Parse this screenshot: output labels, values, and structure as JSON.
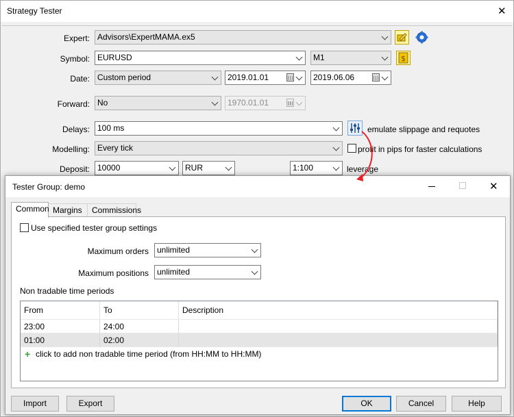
{
  "main_window": {
    "title": "Strategy Tester",
    "expert": {
      "label": "Expert:",
      "value": "Advisors\\ExpertMAMA.ex5"
    },
    "symbol": {
      "label": "Symbol:",
      "value": "EURUSD",
      "timeframe": "M1"
    },
    "date": {
      "label": "Date:",
      "period": "Custom period",
      "from": "2019.01.01",
      "to": "2019.06.06"
    },
    "forward": {
      "label": "Forward:",
      "value": "No",
      "date": "1970.01.01"
    },
    "delays": {
      "label": "Delays:",
      "value": "100 ms",
      "note": "emulate slippage and requotes"
    },
    "modelling": {
      "label": "Modelling:",
      "value": "Every tick",
      "checkbox_label": "profit in pips for faster calculations"
    },
    "deposit": {
      "label": "Deposit:",
      "amount": "10000",
      "currency": "RUR",
      "leverage": "1:100",
      "leverage_label": "leverage"
    }
  },
  "dialog": {
    "title": "Tester Group: demo",
    "tabs": [
      {
        "label": "Common"
      },
      {
        "label": "Margins"
      },
      {
        "label": "Commissions"
      }
    ],
    "use_specified_label": "Use specified tester group settings",
    "max_orders": {
      "label": "Maximum orders",
      "value": "unlimited"
    },
    "max_positions": {
      "label": "Maximum positions",
      "value": "unlimited"
    },
    "periods_label": "Non tradable time periods",
    "table": {
      "columns": [
        "From",
        "To",
        "Description"
      ],
      "rows": [
        {
          "from": "23:00",
          "to": "24:00",
          "description": ""
        },
        {
          "from": "01:00",
          "to": "02:00",
          "description": ""
        }
      ],
      "add_hint": "click to add non tradable time period (from HH:MM to HH:MM)"
    },
    "buttons": {
      "import": "Import",
      "export": "Export",
      "ok": "OK",
      "cancel": "Cancel",
      "help": "Help"
    }
  },
  "colors": {
    "accent": "#0078d7",
    "arrow": "#e8212a",
    "add_plus": "#3aa53a",
    "selected_row": "#e5e5e5"
  }
}
